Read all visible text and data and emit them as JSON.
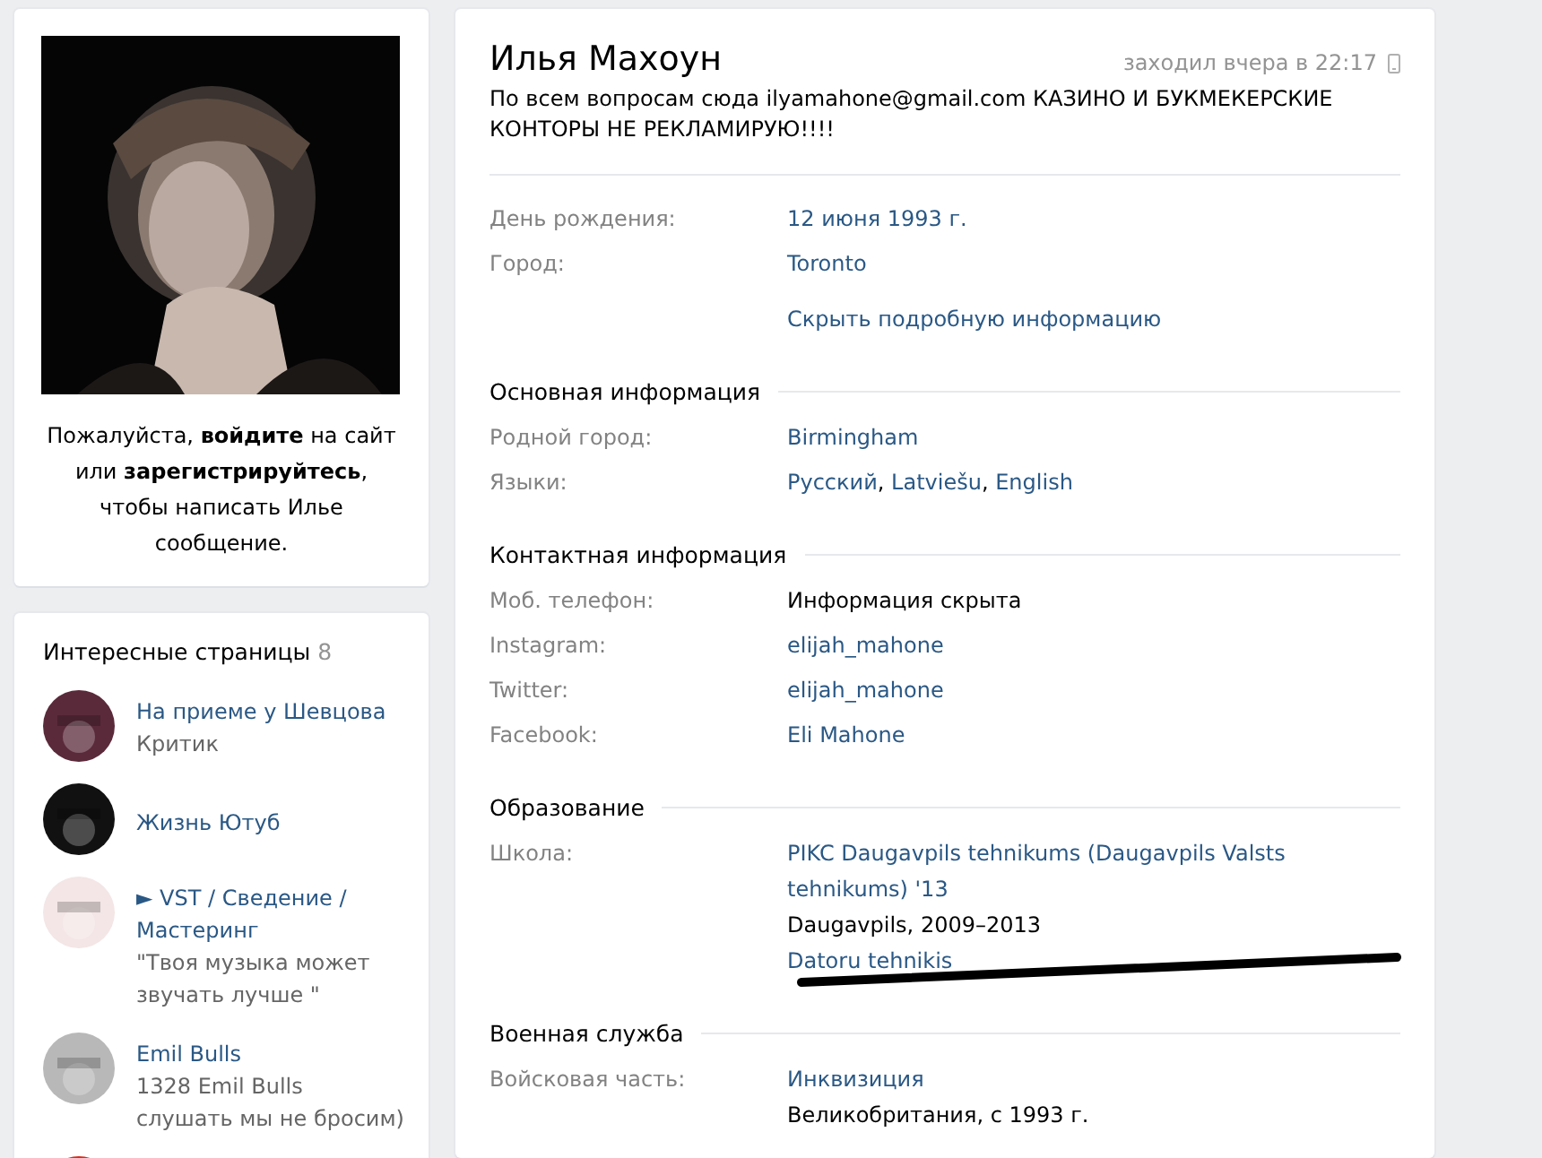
{
  "sidebar": {
    "login_prompt": "Пожалуйста, **войдите** на сайт или **зарегистрируйтесь**, чтобы написать Илье сообщение.",
    "pages": {
      "title": "Интересные страницы",
      "count": "8",
      "items": [
        {
          "title": "На приеме у Шевцова",
          "subtitle": "Критик",
          "color": "#5a2a3a"
        },
        {
          "title": "Жизнь Ютуб",
          "color": "#111111"
        },
        {
          "title": "► VST / Сведение / Мастеринг",
          "subtitle": "\"Твоя музыка может звучать лучше \"",
          "color": "#f4e6e6"
        },
        {
          "title": "Emil Bulls",
          "subtitle": "1328 Emil Bulls слушать мы не бросим)",
          "color": "#b8b8b8"
        },
        {
          "color": "#d03020"
        }
      ]
    }
  },
  "profile": {
    "name": "Илья Махоун",
    "last_seen": "заходил вчера в 22:17",
    "status": "По всем вопросам сюда ilyamahone@gmail.com КАЗИНО И БУКМЕКЕРСКИЕ КОНТОРЫ НЕ РЕКЛАМИРУЮ!!!!",
    "sections": [
      {
        "rows": [
          {
            "label": "День рождения:",
            "lines": [
              [
                {
                  "kind": "link",
                  "text": "12 июня 1993 г."
                }
              ]
            ]
          },
          {
            "label": "Город:",
            "lines": [
              [
                {
                  "kind": "link",
                  "text": "Toronto"
                }
              ]
            ]
          },
          {
            "kind": "toggle",
            "lines": [
              [
                {
                  "kind": "link",
                  "text": "Скрыть подробную информацию"
                }
              ]
            ]
          }
        ]
      },
      {
        "title": "Основная информация",
        "rows": [
          {
            "label": "Родной город:",
            "lines": [
              [
                {
                  "kind": "link",
                  "text": "Birmingham"
                }
              ]
            ]
          },
          {
            "label": "Языки:",
            "lines": [
              [
                {
                  "kind": "link",
                  "text": "Русский"
                },
                {
                  "kind": "text",
                  "text": ", "
                },
                {
                  "kind": "link",
                  "text": "Latviešu"
                },
                {
                  "kind": "text",
                  "text": ", "
                },
                {
                  "kind": "link",
                  "text": "English"
                }
              ]
            ]
          }
        ]
      },
      {
        "title": "Контактная информация",
        "rows": [
          {
            "label": "Моб. телефон:",
            "lines": [
              [
                {
                  "kind": "text",
                  "text": "Информация скрыта"
                }
              ]
            ]
          },
          {
            "label": "Instagram:",
            "lines": [
              [
                {
                  "kind": "link",
                  "text": "elijah_mahone"
                }
              ]
            ]
          },
          {
            "label": "Twitter:",
            "lines": [
              [
                {
                  "kind": "link",
                  "text": "elijah_mahone"
                }
              ]
            ]
          },
          {
            "label": "Facebook:",
            "lines": [
              [
                {
                  "kind": "link",
                  "text": "Eli Mahone"
                }
              ]
            ]
          }
        ]
      },
      {
        "title": "Образование",
        "rows": [
          {
            "label": "Школа:",
            "scribble": true,
            "lines": [
              [
                {
                  "kind": "link",
                  "text": "PIKC Daugavpils tehnikums (Daugavpils Valsts tehnikums) '13"
                }
              ],
              [
                {
                  "kind": "text",
                  "text": "Daugavpils, 2009–2013"
                }
              ],
              [
                {
                  "kind": "link",
                  "text": "Datoru tehnikis"
                }
              ]
            ]
          }
        ]
      },
      {
        "title": "Военная служба",
        "rows": [
          {
            "label": "Войсковая часть:",
            "lines": [
              [
                {
                  "kind": "link",
                  "text": "Инквизиция"
                }
              ],
              [
                {
                  "kind": "text",
                  "text": "Великобритания, с 1993 г."
                }
              ]
            ]
          }
        ]
      }
    ]
  }
}
